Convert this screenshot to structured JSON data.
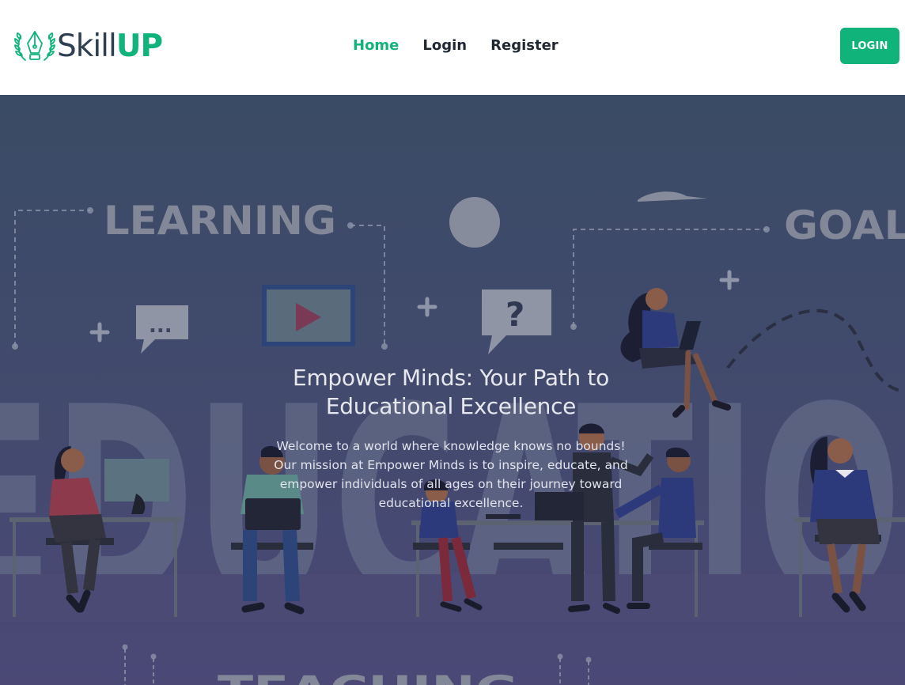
{
  "brand": {
    "name_part1": "Skill",
    "name_part2": "UP",
    "logo_icon": "laurel-pen-icon",
    "colors": {
      "accent": "#10b47a",
      "dark": "#2f3f52"
    }
  },
  "nav": {
    "links": [
      {
        "label": "Home",
        "active": true
      },
      {
        "label": "Login",
        "active": false
      },
      {
        "label": "Register",
        "active": false
      }
    ],
    "cta_label": "LOGIN"
  },
  "hero": {
    "title_line1": "Empower Minds: Your Path to",
    "title_line2": "Educational Excellence",
    "description": "Welcome to a world where knowledge knows no bounds! Our mission at Empower Minds is to inspire, educate, and empower individuals of all ages on their journey toward educational excellence.",
    "background_words": {
      "learning": "LEARNING",
      "goal": "GOAL",
      "education": "EDUCATION",
      "teaching": "TEACHING"
    },
    "speech_bubble_text": "...",
    "question_mark": "?",
    "overlay_color": "#3d4a6b"
  }
}
